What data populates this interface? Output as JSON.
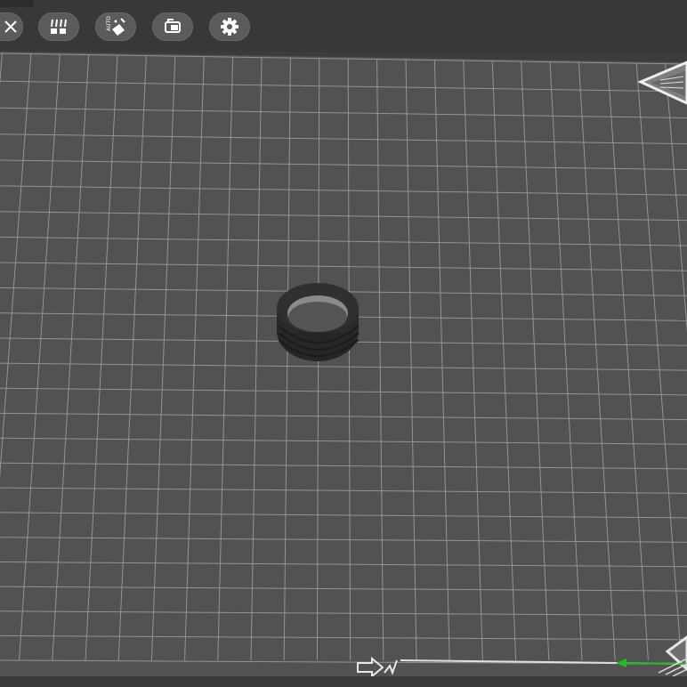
{
  "toolbar": {
    "buttons": [
      {
        "name": "close-button",
        "icon": "close-icon"
      },
      {
        "name": "arrange-button",
        "icon": "arrange-icon"
      },
      {
        "name": "auto-orient-button",
        "icon": "auto-orient-icon",
        "text": "AUTO"
      },
      {
        "name": "object-view-button",
        "icon": "object-view-icon"
      },
      {
        "name": "settings-button",
        "icon": "gear-icon"
      }
    ]
  },
  "viewport": {
    "colors": {
      "bed": "#535353",
      "grid": "#9a9a9a",
      "object": "#2e2e2e",
      "axis_green": "#22bb22"
    }
  }
}
